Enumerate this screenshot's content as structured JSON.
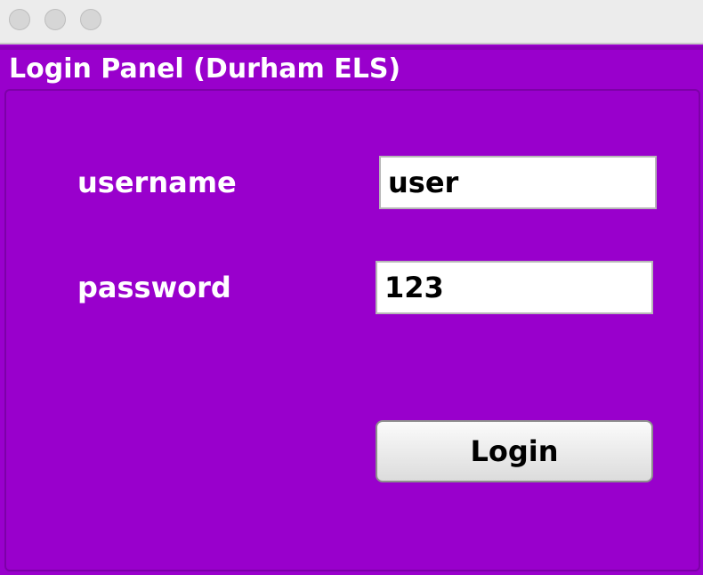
{
  "window": {
    "controls": [
      "close-button",
      "minimize-button",
      "zoom-button"
    ]
  },
  "panel": {
    "title": "Login Panel (Durham ELS)"
  },
  "form": {
    "username_label": "username",
    "username_value": "user",
    "password_label": "password",
    "password_value": "123",
    "login_label": "Login"
  },
  "colors": {
    "background": "#9900cc",
    "title_text": "#ffffff",
    "label_text": "#ffffff"
  }
}
